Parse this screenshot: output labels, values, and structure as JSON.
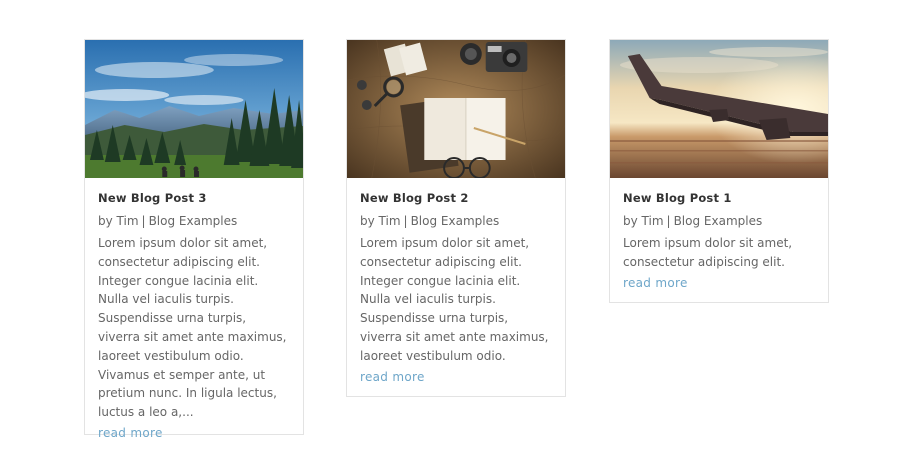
{
  "posts": [
    {
      "title": "New Blog Post 3",
      "author_prefix": "by",
      "author": "Tim",
      "separator": "|",
      "category": "Blog Examples",
      "excerpt": "Lorem ipsum dolor sit amet, consectetur adipiscing elit. Integer congue lacinia elit. Nulla vel iaculis turpis. Suspendisse urna turpis, viverra sit amet ante maximus, laoreet vestibulum odio. Vivamus et semper ante, ut pretium nunc. In ligula lectus, luctus a leo a,...",
      "read_more": "read more",
      "image": "mountain-forest-landscape"
    },
    {
      "title": "New Blog Post 2",
      "author_prefix": "by",
      "author": "Tim",
      "separator": "|",
      "category": "Blog Examples",
      "excerpt": "Lorem ipsum dolor sit amet, consectetur adipiscing elit. Integer congue lacinia elit. Nulla vel iaculis turpis. Suspendisse urna turpis, viverra sit amet ante maximus, laoreet vestibulum odio.",
      "read_more": "read more",
      "image": "travel-desk-map-notebook-camera"
    },
    {
      "title": "New Blog Post 1",
      "author_prefix": "by",
      "author": "Tim",
      "separator": "|",
      "category": "Blog Examples",
      "excerpt": "Lorem ipsum dolor sit amet, consectetur adipiscing elit.",
      "read_more": "read more",
      "image": "airplane-wing-sunset"
    }
  ],
  "colors": {
    "link": "#6ea6c9",
    "title": "#333333",
    "text": "#666666",
    "border": "#e3e3e3"
  }
}
